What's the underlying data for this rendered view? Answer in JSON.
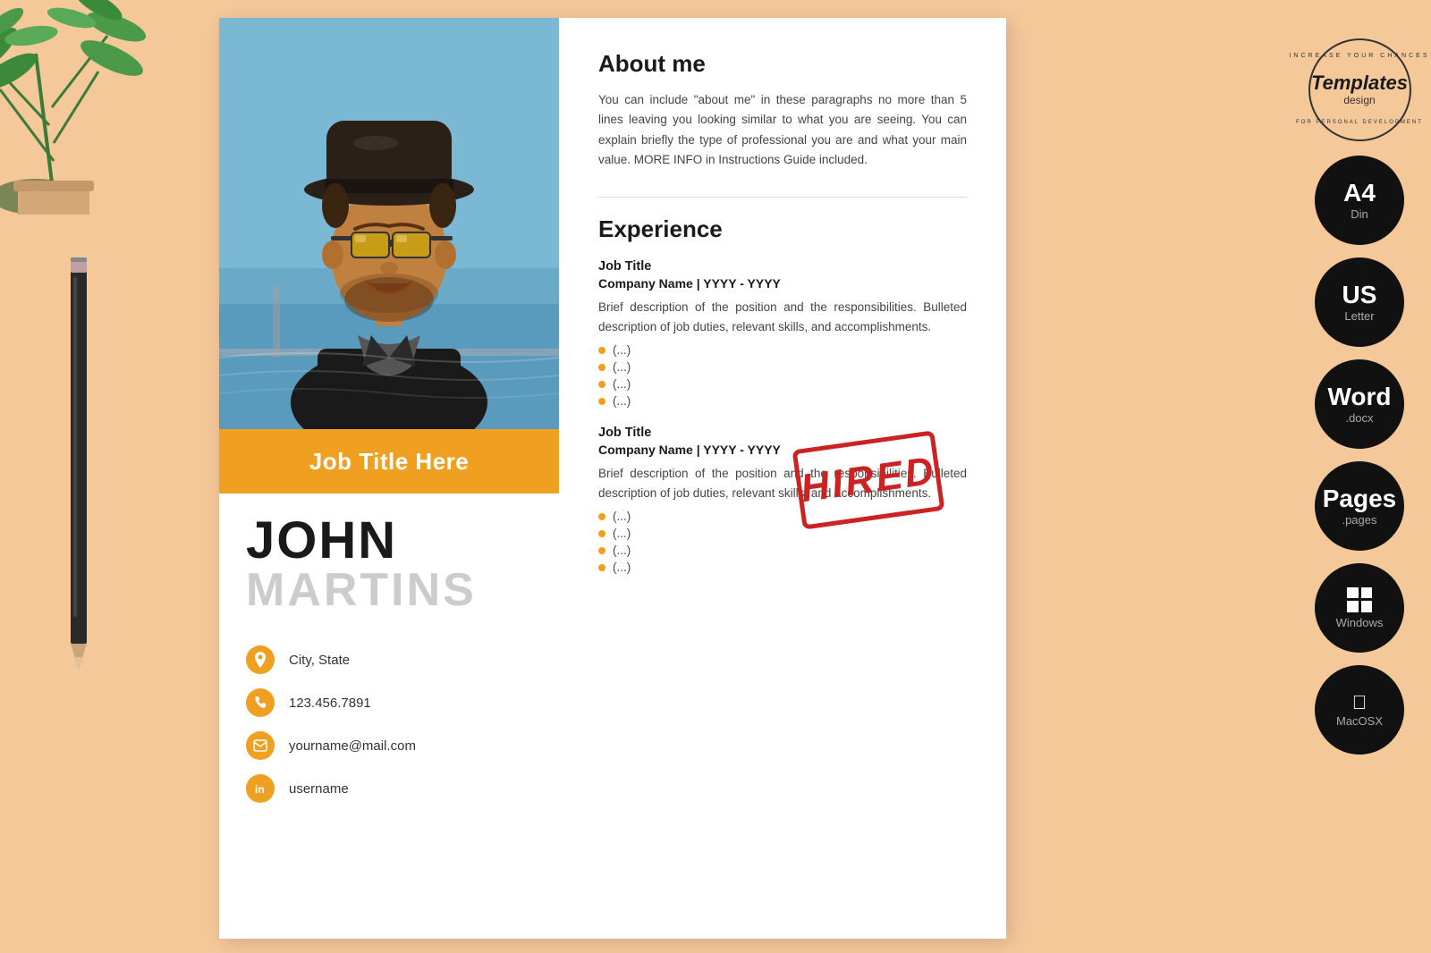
{
  "background_color": "#f5c89a",
  "resume": {
    "photo_alt": "Profile photo of John Martins",
    "job_title_banner": "Job Title Here",
    "first_name": "JOHN",
    "last_name": "MARTINS",
    "contact": {
      "location": "City, State",
      "phone": "123.456.7891",
      "email": "yourname@mail.com",
      "linkedin": "username"
    },
    "about": {
      "title": "About me",
      "text": "You can include \"about me\" in these paragraphs no more than 5 lines leaving you looking similar to what you are seeing. You can explain briefly the type of professional you are and what your main value. MORE INFO in Instructions Guide included."
    },
    "experience": {
      "title": "Experience",
      "items": [
        {
          "job_title": "Job Title",
          "company": "Company Name | YYYY - YYYY",
          "description": "Brief description of the position and the responsibilities. Bulleted description of job duties, relevant skills, and accomplishments.",
          "bullets": [
            "(...)",
            "(...)",
            "(...)",
            "(...)"
          ]
        },
        {
          "job_title": "Job Title",
          "company": "Company Name | YYYY - YYYY",
          "description": "Brief description of the position and the responsibilities. Bulleted description of job duties, relevant skills, and accomplishments.",
          "bullets": [
            "(...)",
            "(...)",
            "(...)",
            "(...)"
          ]
        }
      ]
    }
  },
  "sidebar": {
    "brand": {
      "top_text": "INCREASE YOUR CHANCES",
      "main_text": "Templates",
      "design_text": "design",
      "bottom_text": "FOR PERSONAL DEVELOPMENT"
    },
    "badges": [
      {
        "main": "A4",
        "sub": "Din",
        "id": "a4"
      },
      {
        "main": "US",
        "sub": "Letter",
        "id": "us"
      },
      {
        "main": "Word",
        "sub": ".docx",
        "id": "word"
      },
      {
        "main": "Pages",
        "sub": ".pages",
        "id": "pages"
      },
      {
        "main": "Windows",
        "sub": "",
        "id": "windows"
      },
      {
        "main": "MacOSX",
        "sub": "",
        "id": "mac"
      }
    ]
  },
  "stamp": {
    "text": "HIRED"
  }
}
